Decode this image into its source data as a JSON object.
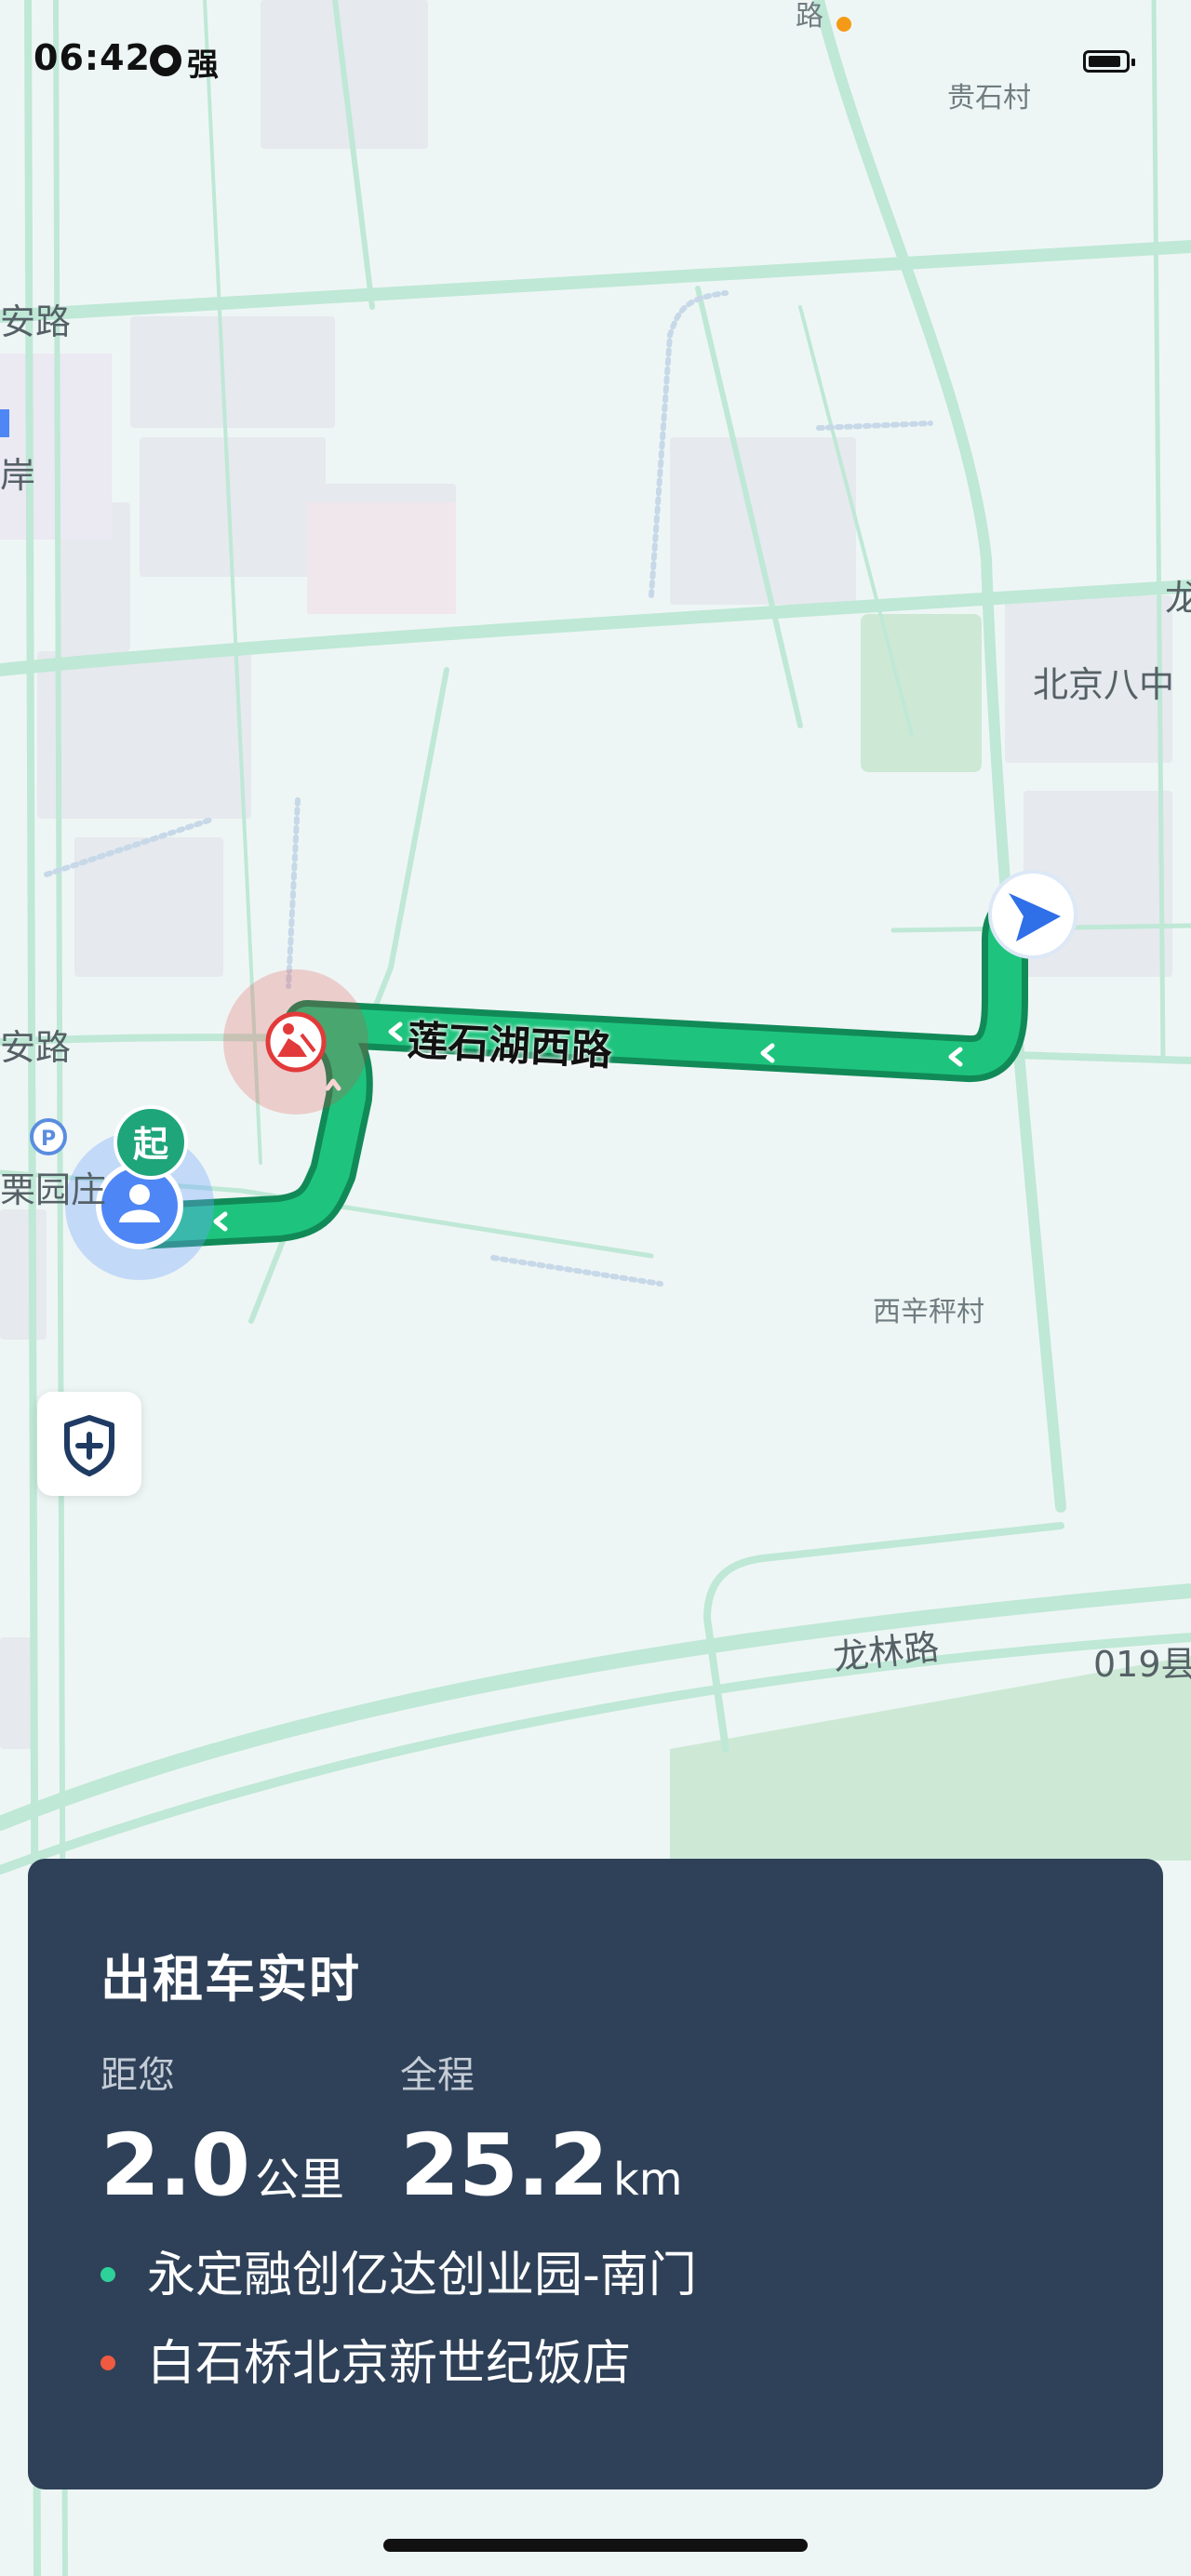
{
  "status_bar": {
    "time": "06:42",
    "signal_icon": "signal-icon",
    "signal_text": "强",
    "battery_icon": "battery-icon"
  },
  "map": {
    "labels": {
      "lu": "路",
      "guishicun": "贵石村",
      "an_lu_top": "安路",
      "an": "岸",
      "long": "龙",
      "beijing_8": "北京八中",
      "an_lu_mid": "安路",
      "liyuanzhuang": "栗园庄",
      "xixinchengcun": "西辛秤村",
      "longlinlu": "龙林路",
      "county_road": "019县"
    },
    "route_road_name": "莲石湖西路",
    "start_marker": "起",
    "colors": {
      "route": "#1ec47e",
      "route_border": "#118a58",
      "road": "#bfe8d6",
      "construction": "#e23a3a",
      "nav_arrow": "#2f6fe8"
    }
  },
  "safety_button_icon": "shield-plus-icon",
  "card": {
    "title": "出租车实时",
    "distance_label": "距您",
    "distance_value": "2.0",
    "distance_unit": "公里",
    "total_label": "全程",
    "total_value": "25.2",
    "total_unit": "km",
    "origin": "永定融创亿达创业园-南门",
    "destination": "白石桥北京新世纪饭店",
    "origin_color": "#2ed19a",
    "destination_color": "#f05a40"
  }
}
